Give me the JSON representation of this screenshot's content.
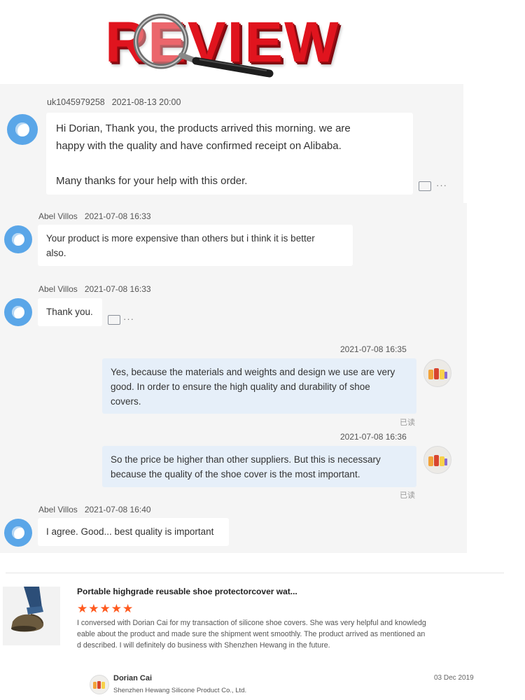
{
  "banner": {
    "word": "REVIEW"
  },
  "chat_top": {
    "sender": "uk1045979258",
    "timestamp": "2021-08-13 20:00",
    "lines": [
      "Hi Dorian, Thank you, the products arrived this morning. we are",
      "happy with the quality and have confirmed receipt on Alibaba.",
      "",
      "Many thanks for your help with this order."
    ]
  },
  "chat": {
    "m1": {
      "sender": "Abel Villos",
      "timestamp": "2021-07-08 16:33",
      "lines": [
        "Your product is more expensive than others but i think it is better",
        "also."
      ]
    },
    "m2": {
      "sender": "Abel Villos",
      "timestamp": "2021-07-08 16:33",
      "text": "Thank you."
    },
    "m3": {
      "timestamp": "2021-07-08 16:35",
      "lines": [
        "Yes, because the materials and weights and design we use are very",
        "good. In order to ensure the high quality and durability of shoe",
        "covers."
      ],
      "read": "已读"
    },
    "m4": {
      "timestamp": "2021-07-08 16:36",
      "lines": [
        "So the price be higher than other suppliers. But this is necessary",
        "because the quality of the shoe cover is the most important."
      ],
      "read": "已读"
    },
    "m5": {
      "sender": "Abel Villos",
      "timestamp": "2021-07-08 16:40",
      "text": "I agree. Good... best quality is important"
    },
    "more_label": "···"
  },
  "review": {
    "product_title": "Portable highgrade reusable shoe protectorcover wat...",
    "rating": 5,
    "stars": "★★★★★",
    "lines": [
      "I conversed with Dorian Cai for my transaction of silicone shoe covers. She was very helpful and knowledg",
      "eable about the product and made sure the shipment went smoothly. The product arrived as mentioned an",
      "d described. I will definitely do business with Shenzhen Hewang in the future."
    ],
    "seller_name": "Dorian Cai",
    "seller_company": "Shenzhen Hewang Silicone Product Co., Ltd.",
    "date": "03 Dec 2019"
  },
  "colors": {
    "accent_red": "#e0141e",
    "chat_bg": "#f5f5f5",
    "self_bubble": "#e6eff9",
    "star": "#ff5a1f",
    "avatar_blue": "#5aa6e8"
  },
  "icons": [
    "magnifier-icon",
    "avatar-icon",
    "translate-icon",
    "more-icon",
    "star-icon"
  ]
}
